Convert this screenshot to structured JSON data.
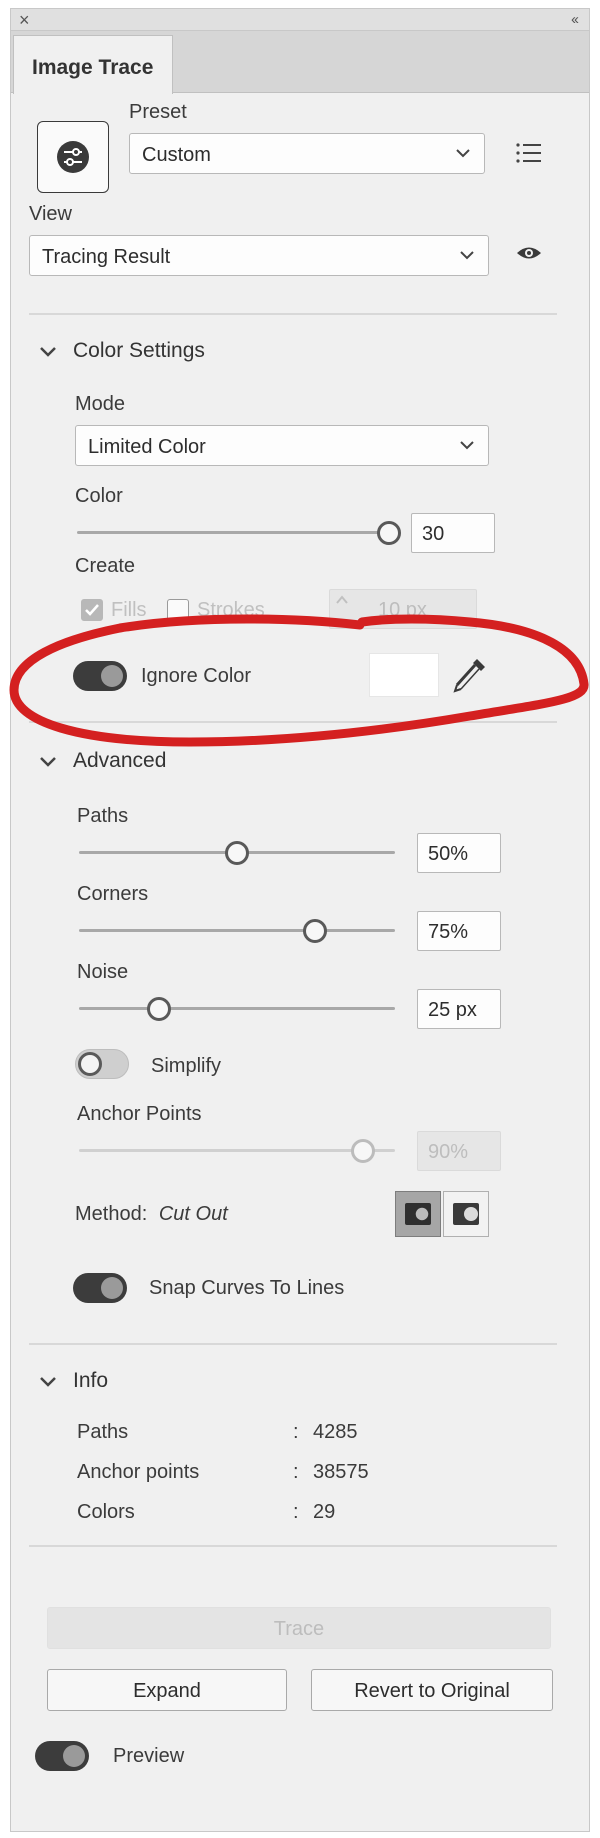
{
  "panel": {
    "tab_title": "Image Trace",
    "close_glyph": "×",
    "collapse_glyph": "‹‹"
  },
  "preset": {
    "label": "Preset",
    "value": "Custom"
  },
  "view": {
    "label": "View",
    "value": "Tracing Result"
  },
  "color_settings": {
    "title": "Color Settings",
    "mode_label": "Mode",
    "mode_value": "Limited Color",
    "color_label": "Color",
    "color_value": "30",
    "color_slider_level": 1.0,
    "create_label": "Create",
    "fills_label": "Fills",
    "fills_checked": true,
    "strokes_label": "Strokes",
    "strokes_checked": false,
    "stroke_value": "10 px",
    "ignore_color_label": "Ignore Color",
    "ignore_color_on": true
  },
  "advanced": {
    "title": "Advanced",
    "paths_label": "Paths",
    "paths_value": "50%",
    "paths_level": 0.5,
    "corners_label": "Corners",
    "corners_value": "75%",
    "corners_level": 0.75,
    "noise_label": "Noise",
    "noise_value": "25 px",
    "noise_level": 0.25,
    "simplify_label": "Simplify",
    "simplify_on": false,
    "anchor_points_label": "Anchor Points",
    "anchor_points_value": "90%",
    "anchor_points_level": 0.9,
    "method_label": "Method:",
    "method_value": "Cut Out",
    "snap_label": "Snap Curves To Lines",
    "snap_on": true
  },
  "info": {
    "title": "Info",
    "rows": [
      {
        "label": "Paths",
        "colon": ":",
        "value": "4285"
      },
      {
        "label": "Anchor points",
        "colon": ":",
        "value": "38575"
      },
      {
        "label": "Colors",
        "colon": ":",
        "value": "29"
      }
    ]
  },
  "buttons": {
    "trace": "Trace",
    "expand": "Expand",
    "revert": "Revert to Original"
  },
  "preview": {
    "label": "Preview",
    "on": true
  },
  "icons": {
    "preset_icon": "sliders-icon",
    "list_icon": "list-icon",
    "eye_icon": "eye-icon",
    "eyedropper_icon": "eyedropper-icon"
  },
  "colors": {
    "annotation_red": "#d42020",
    "toggle_on": "#3c3c3c",
    "panel_bg": "#f0f0f0"
  }
}
